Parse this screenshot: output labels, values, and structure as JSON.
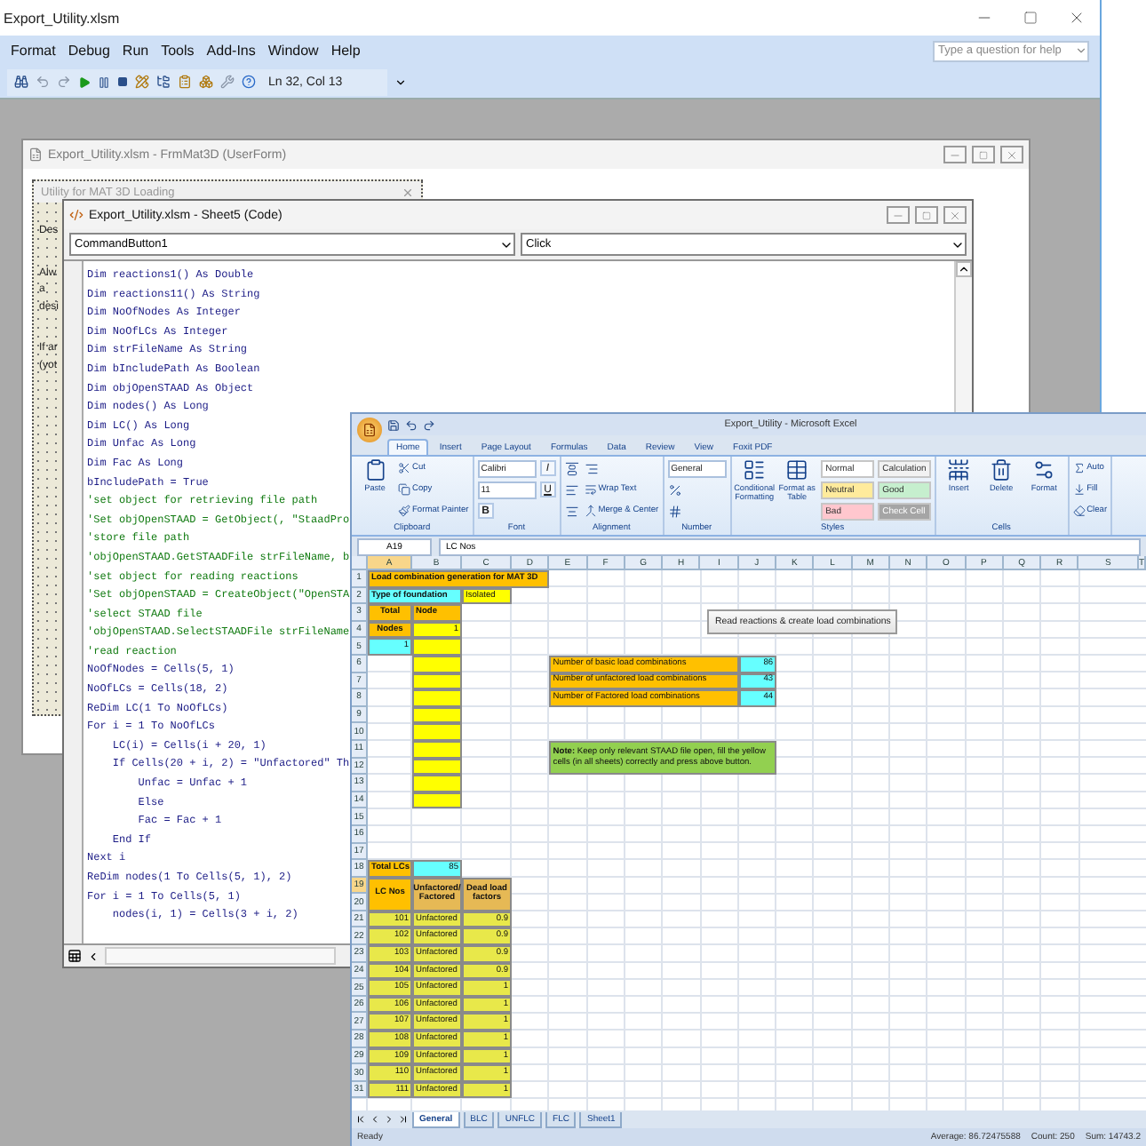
{
  "vbe": {
    "title": "Export_Utility.xlsm",
    "menu": [
      "Format",
      "Debug",
      "Run",
      "Tools",
      "Add-Ins",
      "Window",
      "Help"
    ],
    "help_search": {
      "placeholder": "Type a question for help"
    },
    "position": "Ln 32, Col 13"
  },
  "userform_window": {
    "title": "Export_Utility.xlsm - FrmMat3D (UserForm)",
    "form_title": "Utility for MAT 3D Loading",
    "labels": [
      "Des",
      "Alwa desi",
      "If ar (yot"
    ]
  },
  "code_window": {
    "title": "Export_Utility.xlsm - Sheet5 (Code)",
    "object": "CommandButton1",
    "procedure": "Click",
    "lines": [
      {
        "kind": "code",
        "text": "Dim reactions1() As Double"
      },
      {
        "kind": "code",
        "text": "Dim reactions11() As String"
      },
      {
        "kind": "code",
        "text": "Dim NoOfNodes As Integer"
      },
      {
        "kind": "code",
        "text": "Dim NoOfLCs As Integer"
      },
      {
        "kind": "code",
        "text": "Dim strFileName As String"
      },
      {
        "kind": "code",
        "text": "Dim bIncludePath As Boolean"
      },
      {
        "kind": "code",
        "text": "Dim objOpenSTAAD As Object"
      },
      {
        "kind": "code",
        "text": "Dim nodes() As Long"
      },
      {
        "kind": "code",
        "text": "Dim LC() As Long"
      },
      {
        "kind": "code",
        "text": "Dim Unfac As Long"
      },
      {
        "kind": "code",
        "text": "Dim Fac As Long"
      },
      {
        "kind": "code",
        "text": "bIncludePath = True"
      },
      {
        "kind": "comment",
        "text": "'set object for retrieving file path"
      },
      {
        "kind": "comment",
        "text": "'Set objOpenSTAAD = GetObject(, \"StaadPro"
      },
      {
        "kind": "comment",
        "text": "'store file path"
      },
      {
        "kind": "comment",
        "text": "'objOpenSTAAD.GetSTAADFile strFileName, b"
      },
      {
        "kind": "comment",
        "text": "'set object for reading reactions"
      },
      {
        "kind": "comment",
        "text": "'Set objOpenSTAAD = CreateObject(\"OpenSTA"
      },
      {
        "kind": "comment",
        "text": "'select STAAD file"
      },
      {
        "kind": "comment",
        "text": "'objOpenSTAAD.SelectSTAADFile strFileName"
      },
      {
        "kind": "comment",
        "text": "'read reaction"
      },
      {
        "kind": "code",
        "text": "NoOfNodes = Cells(5, 1)"
      },
      {
        "kind": "code",
        "text": "NoOfLCs = Cells(18, 2)"
      },
      {
        "kind": "code",
        "text": "ReDim LC(1 To NoOfLCs)"
      },
      {
        "kind": "code",
        "text": "For i = 1 To NoOfLCs"
      },
      {
        "kind": "code",
        "text": "    LC(i) = Cells(i + 20, 1)"
      },
      {
        "kind": "code",
        "text": "    If Cells(20 + i, 2) = \"Unfactored\" Th"
      },
      {
        "kind": "code",
        "text": "        Unfac = Unfac + 1"
      },
      {
        "kind": "code",
        "text": "        Else"
      },
      {
        "kind": "code",
        "text": "        Fac = Fac + 1"
      },
      {
        "kind": "code",
        "text": "    End If"
      },
      {
        "kind": "code",
        "text": "Next i"
      },
      {
        "kind": "code",
        "text": "ReDim nodes(1 To Cells(5, 1), 2)"
      },
      {
        "kind": "code",
        "text": "For i = 1 To Cells(5, 1)"
      },
      {
        "kind": "code",
        "text": "    nodes(i, 1) = Cells(3 + i, 2)"
      }
    ]
  },
  "excel": {
    "title": "Export_Utility - Microsoft Excel",
    "tabs": [
      {
        "label": "Home",
        "selected": true
      },
      {
        "label": "Insert",
        "selected": false
      },
      {
        "label": "Page Layout",
        "selected": false
      },
      {
        "label": "Formulas",
        "selected": false
      },
      {
        "label": "Data",
        "selected": false
      },
      {
        "label": "Review",
        "selected": false
      },
      {
        "label": "View",
        "selected": false
      },
      {
        "label": "Foxit PDF",
        "selected": false
      }
    ],
    "ribbon": [
      {
        "label": "Clipboard",
        "items": [
          {
            "kind": "large",
            "text": "Paste"
          },
          {
            "kind": "small",
            "text": "Cut"
          },
          {
            "kind": "small",
            "text": "Copy"
          },
          {
            "kind": "small",
            "text": "Format Painter"
          }
        ]
      },
      {
        "label": "Font",
        "items": [
          {
            "kind": "field",
            "text": "Calibri"
          },
          {
            "kind": "field",
            "text": "11"
          },
          {
            "kind": "letter",
            "text": "B"
          },
          {
            "kind": "letter",
            "text": "I"
          },
          {
            "kind": "letter",
            "text": "U"
          }
        ]
      },
      {
        "label": "Alignment",
        "items": [
          {
            "kind": "icon"
          },
          {
            "kind": "icon"
          },
          {
            "kind": "icon"
          },
          {
            "kind": "icon"
          },
          {
            "kind": "small",
            "text": "Wrap Text"
          },
          {
            "kind": "small",
            "text": "Merge & Center"
          }
        ]
      },
      {
        "label": "Number",
        "items": [
          {
            "kind": "field",
            "text": "General"
          },
          {
            "kind": "icon"
          },
          {
            "kind": "icon"
          }
        ]
      },
      {
        "label": "Styles",
        "items": [
          {
            "kind": "large",
            "text": "Conditional Formatting"
          },
          {
            "kind": "large",
            "text": "Format as Table"
          },
          {
            "kind": "swatch",
            "text": "Normal",
            "color": "#ffffff"
          },
          {
            "kind": "swatch",
            "text": "Neutral",
            "color": "#ffeb9c"
          },
          {
            "kind": "swatch",
            "text": "Bad",
            "color": "#ffc7ce"
          },
          {
            "kind": "swatch",
            "text": "Calculation",
            "color": "#f2f2f2"
          },
          {
            "kind": "swatch",
            "text": "Good",
            "color": "#c6efce"
          },
          {
            "kind": "swatch",
            "text": "Check Cell",
            "color": "#a5a5a5"
          }
        ]
      },
      {
        "label": "Cells",
        "items": [
          {
            "kind": "large",
            "text": "Insert"
          },
          {
            "kind": "large",
            "text": "Delete"
          },
          {
            "kind": "large",
            "text": "Format"
          }
        ]
      },
      {
        "items": [
          {
            "kind": "small",
            "text": "Auto"
          },
          {
            "kind": "small",
            "text": "Fill"
          },
          {
            "kind": "small",
            "text": "Clear"
          }
        ]
      }
    ],
    "name_box": "A19",
    "formula": "LC Nos",
    "sheet": {
      "columns": [
        "A",
        "B",
        "C",
        "D",
        "E",
        "F",
        "G",
        "H",
        "I",
        "J",
        "K",
        "L",
        "M",
        "N",
        "O",
        "P",
        "Q",
        "R",
        "S",
        "T"
      ],
      "rows": [
        {
          "num": "1",
          "cells": [
            {
              "kind": "title",
              "text": "Load combination generation for MAT 3D",
              "color": "#ffc000"
            },
            {
              "kind": "merged"
            },
            {
              "kind": "merged"
            },
            {
              "kind": "merged"
            }
          ]
        },
        {
          "num": "2",
          "cells": [
            {
              "kind": "title",
              "text": "Type of foundation",
              "color": "#66ffff"
            },
            {
              "kind": "merged"
            },
            {
              "kind": "text",
              "text": "Isolated",
              "color": "#ffff00"
            }
          ]
        },
        {
          "num": "3",
          "cells": [
            {
              "kind": "header",
              "text": "Total",
              "color": "#ffc000"
            },
            {
              "kind": "title",
              "text": "Node",
              "color": "#ffc000"
            }
          ]
        },
        {
          "num": "4",
          "cells": [
            {
              "kind": "header",
              "text": "Nodes",
              "color": "#ffc000"
            },
            {
              "kind": "number",
              "text": "1",
              "color": "#ffff00"
            }
          ]
        },
        {
          "num": "5",
          "cells": [
            {
              "kind": "number",
              "text": "1",
              "color": "#66ffff"
            },
            {
              "kind": "blank",
              "color": "#ffff00"
            }
          ]
        },
        {
          "num": "6",
          "cells": [
            {
              "kind": "empty"
            },
            {
              "kind": "blank",
              "color": "#ffff00"
            },
            {
              "kind": "empty"
            },
            {
              "kind": "empty"
            },
            {
              "kind": "text",
              "text": "Number of basic load combinations",
              "color": "#ffc000"
            },
            {
              "kind": "merged"
            },
            {
              "kind": "merged"
            },
            {
              "kind": "merged"
            },
            {
              "kind": "merged"
            },
            {
              "kind": "number",
              "text": "86",
              "color": "#66ffff"
            }
          ]
        },
        {
          "num": "7",
          "cells": [
            {
              "kind": "empty"
            },
            {
              "kind": "blank",
              "color": "#ffff00"
            },
            {
              "kind": "empty"
            },
            {
              "kind": "empty"
            },
            {
              "kind": "text",
              "text": "Number of unfactored load combinations",
              "color": "#ffc000"
            },
            {
              "kind": "merged"
            },
            {
              "kind": "merged"
            },
            {
              "kind": "merged"
            },
            {
              "kind": "merged"
            },
            {
              "kind": "number",
              "text": "43",
              "color": "#66ffff"
            }
          ]
        },
        {
          "num": "8",
          "cells": [
            {
              "kind": "empty"
            },
            {
              "kind": "blank",
              "color": "#ffff00"
            },
            {
              "kind": "empty"
            },
            {
              "kind": "empty"
            },
            {
              "kind": "text",
              "text": "Number of Factored load combinations",
              "color": "#ffc000"
            },
            {
              "kind": "merged"
            },
            {
              "kind": "merged"
            },
            {
              "kind": "merged"
            },
            {
              "kind": "merged"
            },
            {
              "kind": "number",
              "text": "44",
              "color": "#66ffff"
            }
          ]
        },
        {
          "num": "9",
          "cells": [
            {
              "kind": "empty"
            },
            {
              "kind": "blank",
              "color": "#ffff00"
            }
          ]
        },
        {
          "num": "10",
          "cells": [
            {
              "kind": "empty"
            },
            {
              "kind": "blank",
              "color": "#ffff00"
            }
          ]
        },
        {
          "num": "11",
          "cells": [
            {
              "kind": "empty"
            },
            {
              "kind": "blank",
              "color": "#ffff00"
            },
            {
              "kind": "empty"
            },
            {
              "kind": "empty"
            },
            {
              "kind": "note",
              "text": "**Note:** Keep only relevant STAAD file open, fill the yellow cells (in all sheets) correctly and press above button.",
              "color": "#92d050"
            },
            {
              "kind": "merged"
            },
            {
              "kind": "merged"
            },
            {
              "kind": "merged"
            },
            {
              "kind": "merged"
            },
            {
              "kind": "merged"
            }
          ]
        },
        {
          "num": "12",
          "cells": [
            {
              "kind": "empty"
            },
            {
              "kind": "blank",
              "color": "#ffff00"
            },
            {
              "kind": "empty"
            },
            {
              "kind": "empty"
            },
            {
              "kind": "merged_up"
            },
            {
              "kind": "merged_up"
            },
            {
              "kind": "merged_up"
            },
            {
              "kind": "merged_up"
            },
            {
              "kind": "merged_up"
            },
            {
              "kind": "merged_up"
            }
          ]
        },
        {
          "num": "13",
          "cells": [
            {
              "kind": "empty"
            },
            {
              "kind": "blank",
              "color": "#ffff00"
            }
          ]
        },
        {
          "num": "14",
          "cells": [
            {
              "kind": "empty"
            },
            {
              "kind": "blank",
              "color": "#ffff00"
            }
          ]
        },
        {
          "num": "15"
        },
        {
          "num": "16"
        },
        {
          "num": "17"
        },
        {
          "num": "18",
          "cells": [
            {
              "kind": "title",
              "text": "Total LCs",
              "color": "#ffc000"
            },
            {
              "kind": "number",
              "text": "85",
              "color": "#66ffff"
            }
          ]
        },
        {
          "num": "19",
          "cells": [
            {
              "kind": "header",
              "text": "LC Nos",
              "color": "#ffc000"
            },
            {
              "kind": "header",
              "text": "Unfactored/ Factored",
              "color": "#e6b955"
            },
            {
              "kind": "header",
              "text": "Dead load factors",
              "color": "#e6b955"
            }
          ]
        },
        {
          "num": "20",
          "cells": [
            {
              "kind": "merged_up"
            },
            {
              "kind": "merged_up"
            },
            {
              "kind": "merged_up"
            }
          ]
        },
        {
          "num": "21",
          "cells": [
            {
              "kind": "number",
              "text": "101",
              "color": "#e8e84a"
            },
            {
              "kind": "text",
              "text": "Unfactored",
              "color": "#e8e84a"
            },
            {
              "kind": "number",
              "text": "0.9",
              "color": "#e8e84a"
            }
          ]
        },
        {
          "num": "22",
          "cells": [
            {
              "kind": "number",
              "text": "102",
              "color": "#e8e84a"
            },
            {
              "kind": "text",
              "text": "Unfactored",
              "color": "#e8e84a"
            },
            {
              "kind": "number",
              "text": "0.9",
              "color": "#e8e84a"
            }
          ]
        },
        {
          "num": "23",
          "cells": [
            {
              "kind": "number",
              "text": "103",
              "color": "#e8e84a"
            },
            {
              "kind": "text",
              "text": "Unfactored",
              "color": "#e8e84a"
            },
            {
              "kind": "number",
              "text": "0.9",
              "color": "#e8e84a"
            }
          ]
        },
        {
          "num": "24",
          "cells": [
            {
              "kind": "number",
              "text": "104",
              "color": "#e8e84a"
            },
            {
              "kind": "text",
              "text": "Unfactored",
              "color": "#e8e84a"
            },
            {
              "kind": "number",
              "text": "0.9",
              "color": "#e8e84a"
            }
          ]
        },
        {
          "num": "25",
          "cells": [
            {
              "kind": "number",
              "text": "105",
              "color": "#e8e84a"
            },
            {
              "kind": "text",
              "text": "Unfactored",
              "color": "#e8e84a"
            },
            {
              "kind": "number",
              "text": "1",
              "color": "#e8e84a"
            }
          ]
        },
        {
          "num": "26",
          "cells": [
            {
              "kind": "number",
              "text": "106",
              "color": "#e8e84a"
            },
            {
              "kind": "text",
              "text": "Unfactored",
              "color": "#e8e84a"
            },
            {
              "kind": "number",
              "text": "1",
              "color": "#e8e84a"
            }
          ]
        },
        {
          "num": "27",
          "cells": [
            {
              "kind": "number",
              "text": "107",
              "color": "#e8e84a"
            },
            {
              "kind": "text",
              "text": "Unfactored",
              "color": "#e8e84a"
            },
            {
              "kind": "number",
              "text": "1",
              "color": "#e8e84a"
            }
          ]
        },
        {
          "num": "28",
          "cells": [
            {
              "kind": "number",
              "text": "108",
              "color": "#e8e84a"
            },
            {
              "kind": "text",
              "text": "Unfactored",
              "color": "#e8e84a"
            },
            {
              "kind": "number",
              "text": "1",
              "color": "#e8e84a"
            }
          ]
        },
        {
          "num": "29",
          "cells": [
            {
              "kind": "number",
              "text": "109",
              "color": "#e8e84a"
            },
            {
              "kind": "text",
              "text": "Unfactored",
              "color": "#e8e84a"
            },
            {
              "kind": "number",
              "text": "1",
              "color": "#e8e84a"
            }
          ]
        },
        {
          "num": "30",
          "cells": [
            {
              "kind": "number",
              "text": "110",
              "color": "#e8e84a"
            },
            {
              "kind": "text",
              "text": "Unfactored",
              "color": "#e8e84a"
            },
            {
              "kind": "number",
              "text": "1",
              "color": "#e8e84a"
            }
          ]
        },
        {
          "num": "31",
          "cells": [
            {
              "kind": "number",
              "text": "111",
              "color": "#e8e84a"
            },
            {
              "kind": "text",
              "text": "Unfactored",
              "color": "#e8e84a"
            },
            {
              "kind": "number",
              "text": "1",
              "color": "#e8e84a"
            }
          ]
        }
      ],
      "button": "Read reactions & create load combinations"
    },
    "sheet_tabs": [
      {
        "label": "General",
        "selected": true
      },
      {
        "label": "BLC",
        "selected": false
      },
      {
        "label": "UNFLC",
        "selected": false
      },
      {
        "label": "FLC",
        "selected": false
      },
      {
        "label": "Sheet1",
        "selected": false
      }
    ],
    "status": {
      "mode": "Ready",
      "stats": [
        "Average: 86.72475588",
        "Count: 250",
        "Sum: 14743.2"
      ]
    }
  }
}
